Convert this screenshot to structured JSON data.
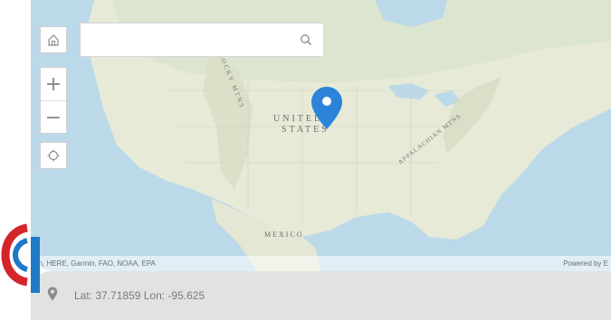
{
  "map": {
    "labels": {
      "country_line1": "UNITED",
      "country_line2": "STATES",
      "mexico": "MEXICO",
      "appalachian": "APPALACHIAN MTNS",
      "rocky": "ROCKY MTNS"
    },
    "attribution": "ton, HERE, Garmin, FAO, NOAA, EPA",
    "powered_by": "Powered by E",
    "colors": {
      "water": "#bcd9ea",
      "land": "#e6ead6",
      "pin": "#2b84d9"
    }
  },
  "controls": {
    "home_icon": "home-icon",
    "search_placeholder": "",
    "search_icon": "search-icon",
    "zoom_in": "+",
    "zoom_out": "−",
    "locate_icon": "locate-icon"
  },
  "status": {
    "coords_text": "Lat: 37.71859  Lon: -95.625"
  }
}
